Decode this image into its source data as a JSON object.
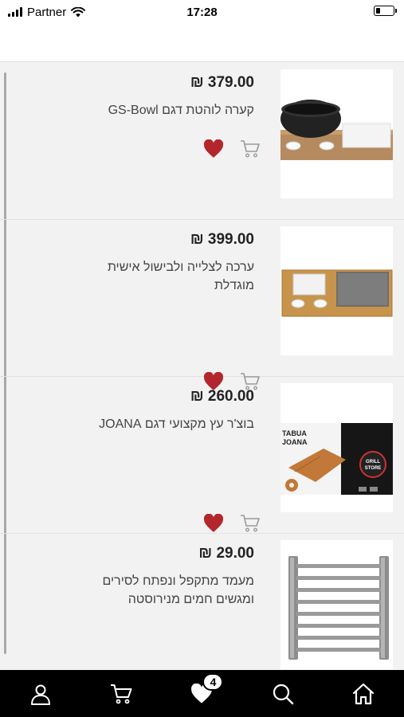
{
  "status_bar": {
    "carrier": "Partner",
    "time": "17:28"
  },
  "products": [
    {
      "price": "₪ 379.00",
      "title": "קערה לוהטת דגם GS-Bowl",
      "image": "black-bowl-on-wooden-board"
    },
    {
      "price": "₪ 399.00",
      "title": "ערכה לצלייה ולבישול אישית מוגדלת",
      "image": "bamboo-tray-with-stone"
    },
    {
      "price": "₪ 260.00",
      "title": "בוצ'ר עץ מקצועי דגם JOANA",
      "image": "wooden-board-with-box",
      "image_text": {
        "brand": "TABUA JOANA",
        "logo": "GRILL STORE"
      }
    },
    {
      "price": "₪ 29.00",
      "title": "מעמד מתקפל ונפתח לסירים ומגשים חמים מנירוסטה",
      "image": "steel-trivet"
    }
  ],
  "tabbar": {
    "items": [
      "user-icon",
      "cart-icon",
      "heart-icon",
      "search-icon",
      "home-icon"
    ],
    "wishlist_count": "4"
  },
  "colors": {
    "heart": "#b3262b",
    "tabbar_bg": "#000000",
    "list_bg": "#f2f2f2"
  }
}
